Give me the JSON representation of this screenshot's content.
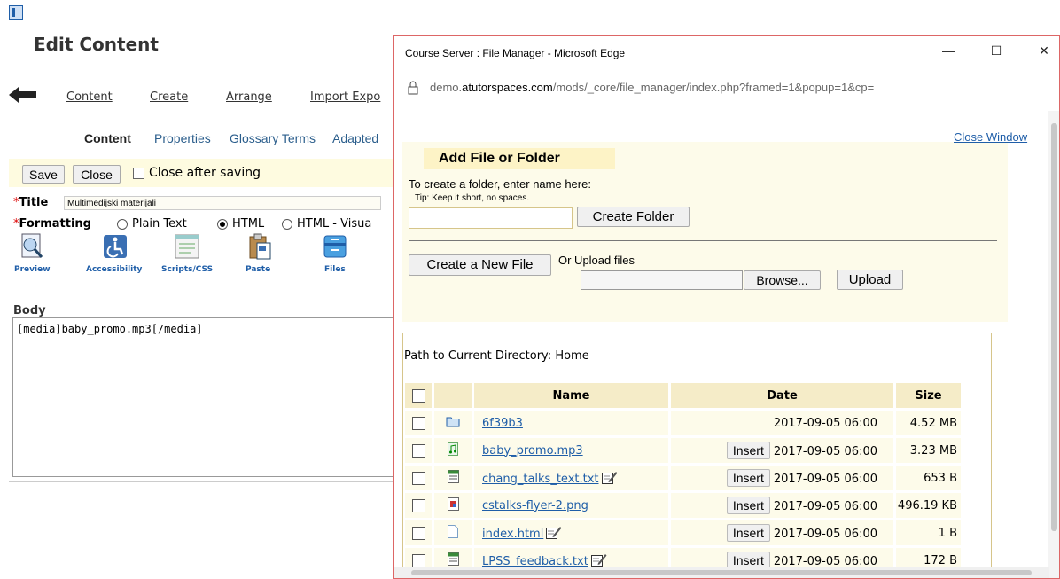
{
  "editor": {
    "page_title": "Edit Content",
    "nav": [
      "Content",
      "Create",
      "Arrange",
      "Import Expo"
    ],
    "subtabs": [
      "Content",
      "Properties",
      "Glossary Terms",
      "Adapted"
    ],
    "save_label": "Save",
    "close_label": "Close",
    "close_after_saving": "Close after saving",
    "title_label": "Title",
    "title_value": "Multimedijski materijali",
    "formatting_label": "Formatting",
    "format_options": [
      "Plain Text",
      "HTML",
      "HTML - Visua"
    ],
    "format_selected": "HTML",
    "tools": [
      "Preview",
      "Accessibility",
      "Scripts/CSS",
      "Paste",
      "Files"
    ],
    "body_label": "Body",
    "body_value": "[media]baby_promo.mp3[/media]",
    "required_marker": "*"
  },
  "popup": {
    "window_title": "Course Server : File Manager - Microsoft Edge",
    "controls": [
      "—",
      "☐",
      "✕"
    ],
    "url_prefix": "demo.",
    "url_domain": "atutorspaces.com",
    "url_path": "/mods/_core/file_manager/index.php?framed=1&popup=1&cp=",
    "close_window": "Close Window",
    "add_heading": "Add File or Folder",
    "folder_prompt": "To create a folder, enter name here:",
    "folder_tip": "Tip: Keep it short, no spaces.",
    "folder_input": "",
    "create_folder": "Create Folder",
    "create_file": "Create a New File",
    "or_upload": "Or Upload files",
    "browse": "Browse...",
    "upload": "Upload",
    "path_label": "Path to Current Directory: Home",
    "columns": [
      "Name",
      "Date",
      "Size"
    ],
    "insert_label": "Insert",
    "files": [
      {
        "name": "6f39b3",
        "type": "folder",
        "date": "2017-09-05 06:00",
        "size": "4.52 MB",
        "insert": false,
        "editable": false
      },
      {
        "name": "baby_promo.mp3",
        "type": "audio",
        "date": "2017-09-05 06:00",
        "size": "3.23 MB",
        "insert": true,
        "editable": false
      },
      {
        "name": "chang_talks_text.txt",
        "type": "text",
        "date": "2017-09-05 06:00",
        "size": "653 B",
        "insert": true,
        "editable": true
      },
      {
        "name": "cstalks-flyer-2.png",
        "type": "image",
        "date": "2017-09-05 06:00",
        "size": "496.19 KB",
        "insert": true,
        "editable": false
      },
      {
        "name": "index.html",
        "type": "html",
        "date": "2017-09-05 06:00",
        "size": "1 B",
        "insert": true,
        "editable": true
      },
      {
        "name": "LPSS_feedback.txt",
        "type": "text",
        "date": "2017-09-05 06:00",
        "size": "172 B",
        "insert": true,
        "editable": true
      }
    ]
  }
}
